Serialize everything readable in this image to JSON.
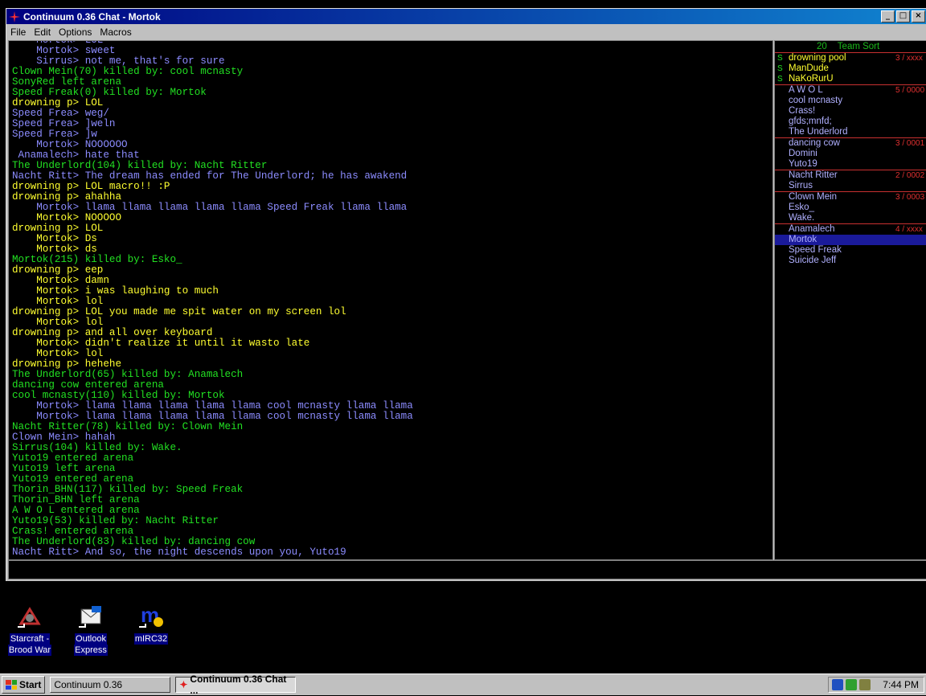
{
  "window": {
    "title": "Continuum 0.36 Chat - Mortok",
    "controls": {
      "minimize": "_",
      "maximize": "□",
      "close": "×"
    }
  },
  "menu": [
    "File",
    "Edit",
    "Options",
    "Macros"
  ],
  "chat_lines": [
    {
      "t": "    Mortok> LOL",
      "k": "chat"
    },
    {
      "t": "    Mortok> sweet",
      "k": "chat"
    },
    {
      "t": "    Sirrus> not me, that's for sure",
      "k": "chat"
    },
    {
      "t": "Clown Mein(70) killed by: cool mcnasty",
      "k": "arena"
    },
    {
      "t": "SonyRed left arena",
      "k": "arena"
    },
    {
      "t": "Speed Freak(0) killed by: Mortok",
      "k": "arena"
    },
    {
      "t": "drowning p> LOL",
      "k": "team"
    },
    {
      "t": "Speed Frea> weg/",
      "k": "chat"
    },
    {
      "t": "Speed Frea> ]weln",
      "k": "chat"
    },
    {
      "t": "Speed Frea> ]w",
      "k": "chat"
    },
    {
      "t": "    Mortok> NOOOOOO",
      "k": "chat"
    },
    {
      "t": " Anamalech> hate that",
      "k": "chat"
    },
    {
      "t": "The Underlord(104) killed by: Nacht Ritter",
      "k": "arena"
    },
    {
      "t": "Nacht Ritt> The dream has ended for The Underlord; he has awakend",
      "k": "chat"
    },
    {
      "t": "drowning p> LOL macro!! :P",
      "k": "team"
    },
    {
      "t": "drowning p> ahahha",
      "k": "team"
    },
    {
      "t": "    Mortok> llama llama llama llama llama Speed Freak llama llama",
      "k": "chat"
    },
    {
      "t": "    Mortok> NOOOOO",
      "k": "team"
    },
    {
      "t": "drowning p> LOL",
      "k": "team"
    },
    {
      "t": "    Mortok> Ds",
      "k": "team"
    },
    {
      "t": "    Mortok> ds",
      "k": "team"
    },
    {
      "t": "Mortok(215) killed by: Esko_",
      "k": "arena"
    },
    {
      "t": "drowning p> eep",
      "k": "team"
    },
    {
      "t": "    Mortok> damn",
      "k": "team"
    },
    {
      "t": "    Mortok> i was laughing to much",
      "k": "team"
    },
    {
      "t": "    Mortok> lol",
      "k": "team"
    },
    {
      "t": "drowning p> LOL you made me spit water on my screen lol",
      "k": "team"
    },
    {
      "t": "    Mortok> lol",
      "k": "team"
    },
    {
      "t": "drowning p> and all over keyboard",
      "k": "team"
    },
    {
      "t": "    Mortok> didn't realize it until it wasto late",
      "k": "team"
    },
    {
      "t": "    Mortok> lol",
      "k": "team"
    },
    {
      "t": "drowning p> hehehe",
      "k": "team"
    },
    {
      "t": "The Underlord(65) killed by: Anamalech",
      "k": "arena"
    },
    {
      "t": "dancing cow entered arena",
      "k": "arena"
    },
    {
      "t": "cool mcnasty(110) killed by: Mortok",
      "k": "arena"
    },
    {
      "t": "    Mortok> llama llama llama llama llama cool mcnasty llama llama",
      "k": "chat"
    },
    {
      "t": "    Mortok> llama llama llama llama llama cool mcnasty llama llama",
      "k": "chat"
    },
    {
      "t": "Nacht Ritter(78) killed by: Clown Mein",
      "k": "arena"
    },
    {
      "t": "Clown Mein> hahah",
      "k": "chat"
    },
    {
      "t": "Sirrus(104) killed by: Wake.",
      "k": "arena"
    },
    {
      "t": "Yuto19 entered arena",
      "k": "arena"
    },
    {
      "t": "Yuto19 left arena",
      "k": "arena"
    },
    {
      "t": "Yuto19 entered arena",
      "k": "arena"
    },
    {
      "t": "Thorin_BHN(117) killed by: Speed Freak",
      "k": "arena"
    },
    {
      "t": "Thorin_BHN left arena",
      "k": "arena"
    },
    {
      "t": "A W O L entered arena",
      "k": "arena"
    },
    {
      "t": "Yuto19(53) killed by: Nacht Ritter",
      "k": "arena"
    },
    {
      "t": "Crass! entered arena",
      "k": "arena"
    },
    {
      "t": "The Underlord(83) killed by: dancing cow",
      "k": "arena"
    },
    {
      "t": "Nacht Ritt> And so, the night descends upon you, Yuto19",
      "k": "chat"
    }
  ],
  "player_list": {
    "count": "20",
    "sort_label": "Team Sort",
    "players": [
      {
        "mark": "S",
        "name": "drowning pool",
        "score": "3 / xxxx",
        "color": "team",
        "sep": false
      },
      {
        "mark": "S",
        "name": "ManDude",
        "score": "",
        "color": "team",
        "sep": false
      },
      {
        "mark": "S",
        "name": "NaKoRurU",
        "score": "",
        "color": "team",
        "sep": false
      },
      {
        "mark": "",
        "name": "A W O L",
        "score": "5 / 0000",
        "color": "purple",
        "sep": true
      },
      {
        "mark": "",
        "name": "cool mcnasty",
        "score": "",
        "color": "purple",
        "sep": false
      },
      {
        "mark": "",
        "name": "Crass!",
        "score": "",
        "color": "purple",
        "sep": false
      },
      {
        "mark": "",
        "name": "gfds;mnfd;",
        "score": "",
        "color": "purple",
        "sep": false
      },
      {
        "mark": "",
        "name": "The Underlord",
        "score": "",
        "color": "purple",
        "sep": false
      },
      {
        "mark": "",
        "name": "dancing cow",
        "score": "3 / 0001",
        "color": "purple",
        "sep": true
      },
      {
        "mark": "",
        "name": "Domini",
        "score": "",
        "color": "purple",
        "sep": false
      },
      {
        "mark": "",
        "name": "Yuto19",
        "score": "",
        "color": "purple",
        "sep": false
      },
      {
        "mark": "",
        "name": "Nacht Ritter",
        "score": "2 / 0002",
        "color": "purple",
        "sep": true
      },
      {
        "mark": "",
        "name": "Sirrus",
        "score": "",
        "color": "purple",
        "sep": false
      },
      {
        "mark": "",
        "name": "Clown Mein",
        "score": "3 / 0003",
        "color": "purple",
        "sep": true
      },
      {
        "mark": "",
        "name": "Esko_",
        "score": "",
        "color": "purple",
        "sep": false
      },
      {
        "mark": "",
        "name": "Wake.",
        "score": "",
        "color": "purple",
        "sep": false
      },
      {
        "mark": "",
        "name": "Anamalech",
        "score": "4 / xxxx",
        "color": "purple",
        "sep": true
      },
      {
        "mark": "",
        "name": "Mortok",
        "score": "",
        "color": "purple",
        "sep": false,
        "selected": true
      },
      {
        "mark": "",
        "name": "Speed Freak",
        "score": "",
        "color": "purple",
        "sep": false
      },
      {
        "mark": "",
        "name": "Suicide Jeff",
        "score": "",
        "color": "purple",
        "sep": false
      }
    ]
  },
  "desktop_icons": [
    {
      "label1": "Starcraft -",
      "label2": "Brood War",
      "icon": "starcraft-icon"
    },
    {
      "label1": "Outlook",
      "label2": "Express",
      "icon": "outlook-express-icon"
    },
    {
      "label1": "mIRC32",
      "label2": "",
      "icon": "mirc-icon"
    }
  ],
  "taskbar": {
    "start": "Start",
    "tasks": [
      "Continuum 0.36",
      "Continuum 0.36 Chat ..."
    ],
    "clock": "7:44 PM"
  },
  "colors": {
    "chat": "#8c8cff",
    "arena": "#22e022",
    "team": "#ffff30",
    "score": "#e03030",
    "selected": "#1a1a9a"
  }
}
